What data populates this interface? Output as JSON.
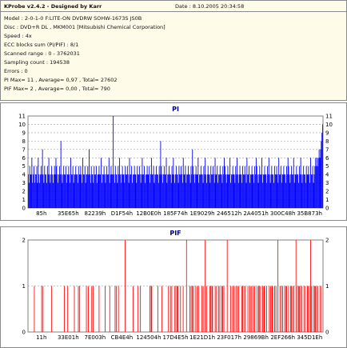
{
  "info": {
    "title": "KProbe v2.4.2 - Designed by Karr",
    "date": "Date : 8.10.2005 20:34:58",
    "lines": [
      "Model : 2-0-1-0 F:LITE-ON DVDRW SOHW-1673S JS0B",
      "Disc : DVD+R DL , MKM001 [Mitsubishi Chemical Corporation]",
      "Speed : 4x",
      "ECC blocks sum (PI/PIF) : 8/1",
      "Scanned range : 0 - 3762031",
      "Sampling count : 194538",
      "Errors : 0",
      "PI Max= 11 , Average= 0,97 , Total= 27602",
      "PIF Max= 2 , Average= 0,00 , Total= 790"
    ]
  },
  "chart_data": [
    {
      "type": "bar",
      "title": "PI",
      "ylim": [
        0,
        11
      ],
      "y_ticks": [
        0,
        1,
        2,
        3,
        4,
        5,
        6,
        7,
        8,
        9,
        10,
        11
      ],
      "x_tick_labels": [
        "85h",
        "35E65h",
        "82239h",
        "D1F54h",
        "12B0E0h",
        "185F74h",
        "1E9029h",
        "246512h",
        "2A4051h",
        "300C48h",
        "35B873h"
      ],
      "grid": true,
      "color": "#0000ff",
      "series": [
        {
          "values": [
            4,
            3,
            5,
            4,
            4,
            6,
            3,
            4,
            5,
            3,
            4,
            4,
            5,
            3,
            6,
            4,
            3,
            4,
            5,
            4,
            7,
            4,
            3,
            5,
            4,
            4,
            3,
            5,
            4,
            6,
            4,
            3,
            4,
            5,
            4,
            3,
            4,
            5,
            4,
            6,
            5,
            4,
            3,
            4,
            5,
            4,
            8,
            4,
            3,
            4,
            5,
            4,
            4,
            5,
            3,
            4,
            4,
            5,
            4,
            3,
            6,
            4,
            4,
            5,
            3,
            4,
            4,
            5,
            4,
            4,
            3,
            5,
            4,
            4,
            5,
            4,
            3,
            6,
            4,
            4,
            5,
            3,
            4,
            4,
            5,
            4,
            7,
            4,
            3,
            5,
            4,
            4,
            3,
            5,
            4,
            4,
            5,
            3,
            4,
            4,
            5,
            4,
            4,
            6,
            3,
            4,
            4,
            5,
            4,
            3,
            4,
            5,
            4,
            4,
            6,
            3,
            4,
            5,
            4,
            4,
            11,
            4,
            3,
            5,
            4,
            4,
            3,
            5,
            4,
            6,
            4,
            3,
            4,
            5,
            4,
            4,
            3,
            5,
            4,
            4,
            5,
            4,
            3,
            6,
            4,
            4,
            5,
            3,
            4,
            4,
            5,
            4,
            4,
            3,
            5,
            4,
            4,
            5,
            4,
            3,
            4,
            6,
            4,
            4,
            5,
            3,
            4,
            4,
            5,
            4,
            4,
            5,
            3,
            4,
            6,
            4,
            4,
            5,
            3,
            4,
            4,
            5,
            4,
            4,
            3,
            5,
            4,
            8,
            5,
            4,
            3,
            4,
            5,
            4,
            4,
            6,
            3,
            4,
            4,
            5,
            4,
            4,
            3,
            5,
            4,
            6,
            4,
            3,
            4,
            5,
            4,
            4,
            3,
            5,
            4,
            4,
            5,
            4,
            3,
            6,
            4,
            4,
            5,
            3,
            4,
            4,
            5,
            4,
            4,
            3,
            5,
            4,
            7,
            5,
            4,
            3,
            4,
            5,
            4,
            4,
            6,
            3,
            4,
            4,
            5,
            4,
            4,
            3,
            5,
            4,
            6,
            4,
            3,
            4,
            5,
            4,
            4,
            3,
            5,
            4,
            4,
            5,
            4,
            3,
            6,
            4,
            4,
            5,
            3,
            4,
            4,
            5,
            4,
            4,
            3,
            5,
            4,
            6,
            5,
            4,
            3,
            4,
            5,
            4,
            4,
            6,
            3,
            4,
            4,
            5,
            4,
            4,
            3,
            5,
            4,
            6,
            4,
            3,
            4,
            5,
            4,
            4,
            3,
            5,
            4,
            4,
            5,
            4,
            3,
            6,
            4,
            4,
            5,
            3,
            4,
            4,
            5,
            4,
            4,
            3,
            5,
            4,
            6,
            5,
            4,
            3,
            4,
            5,
            4,
            4,
            6,
            3,
            4,
            4,
            5,
            4,
            4,
            3,
            5,
            4,
            6,
            4,
            3,
            4,
            5,
            4,
            4,
            3,
            5,
            4,
            4,
            5,
            4,
            3,
            6,
            4,
            4,
            5,
            3,
            4,
            4,
            5,
            4,
            4,
            3,
            5,
            4,
            6,
            5,
            4,
            3,
            4,
            5,
            4,
            4,
            6,
            3,
            4,
            4,
            5,
            4,
            4,
            3,
            5,
            4,
            6,
            4,
            3,
            4,
            5,
            4,
            4,
            3,
            5,
            4,
            4,
            5,
            4,
            3,
            6,
            4,
            4,
            5,
            3,
            4,
            5,
            6,
            5,
            6,
            5,
            6,
            7,
            6,
            7,
            8,
            9,
            10
          ]
        }
      ]
    },
    {
      "type": "bar",
      "title": "PIF",
      "ylim": [
        0,
        2
      ],
      "y_ticks": [
        0,
        1,
        2
      ],
      "x_tick_labels": [
        "11h",
        "33E01h",
        "7E003h",
        "CB4E4h",
        "124504h",
        "17D4E5h",
        "1E21D1h",
        "23F017h",
        "29869Bh",
        "2EF266h",
        "345D1Eh"
      ],
      "grid": true,
      "color": "#ff0000",
      "series": [
        {
          "values": [
            0,
            0,
            0,
            0,
            0,
            0,
            0,
            0,
            0,
            1,
            0,
            0,
            0,
            0,
            0,
            0,
            0,
            0,
            0,
            0,
            1,
            0,
            1,
            0,
            0,
            0,
            0,
            0,
            0,
            0,
            0,
            0,
            0,
            0,
            0,
            1,
            0,
            0,
            0,
            0,
            0,
            0,
            0,
            0,
            0,
            0,
            0,
            0,
            0,
            0,
            0,
            0,
            0,
            0,
            1,
            0,
            0,
            0,
            0,
            1,
            0,
            0,
            0,
            0,
            0,
            0,
            0,
            0,
            0,
            1,
            0,
            0,
            0,
            0,
            0,
            1,
            0,
            1,
            0,
            0,
            0,
            0,
            0,
            0,
            0,
            0,
            0,
            1,
            0,
            0,
            1,
            0,
            0,
            0,
            0,
            1,
            0,
            1,
            0,
            0,
            0,
            0,
            0,
            0,
            0,
            0,
            1,
            0,
            0,
            0,
            0,
            0,
            0,
            0,
            0,
            1,
            0,
            0,
            0,
            0,
            0,
            0,
            1,
            0,
            0,
            0,
            0,
            0,
            0,
            0,
            1,
            0,
            1,
            0,
            0,
            1,
            0,
            0,
            0,
            0,
            0,
            0,
            0,
            0,
            0,
            2,
            0,
            0,
            0,
            0,
            0,
            0,
            0,
            0,
            0,
            0,
            0,
            1,
            0,
            0,
            0,
            0,
            0,
            0,
            1,
            0,
            0,
            0,
            1,
            0,
            0,
            0,
            0,
            0,
            0,
            0,
            0,
            0,
            0,
            0,
            0,
            0,
            1,
            0,
            1,
            1,
            0,
            0,
            0,
            0,
            0,
            0,
            0,
            0,
            1,
            0,
            0,
            0,
            0,
            0,
            1,
            0,
            0,
            0,
            0,
            0,
            0,
            0,
            0,
            0,
            1,
            0,
            0,
            1,
            0,
            1,
            0,
            0,
            0,
            1,
            0,
            1,
            0,
            1,
            1,
            0,
            0,
            0,
            1,
            0,
            0,
            0,
            1,
            0,
            0,
            0,
            0,
            2,
            0,
            0,
            0,
            0,
            1,
            0,
            1,
            0,
            1,
            1,
            0,
            0,
            1,
            0,
            0,
            1,
            0,
            1,
            0,
            0,
            0,
            0,
            1,
            0,
            1,
            0,
            0,
            2,
            0,
            1,
            0,
            0,
            0,
            0,
            1,
            1,
            0,
            1,
            1,
            0,
            0,
            0,
            1,
            0,
            1,
            0,
            0,
            1,
            0,
            1,
            0,
            0,
            1,
            1,
            0,
            1,
            0,
            0,
            0,
            0,
            2,
            0,
            0,
            0,
            0,
            1,
            0,
            0,
            1,
            0,
            1,
            0,
            0,
            1,
            0,
            1,
            0,
            1,
            0,
            0,
            0,
            0,
            1,
            1,
            0,
            1,
            0,
            1,
            0,
            0,
            0,
            1,
            0,
            0,
            1,
            0,
            1,
            0,
            0,
            1,
            0,
            1,
            0,
            0,
            0,
            1,
            0,
            1,
            1,
            0,
            1,
            0,
            0,
            1,
            0,
            1,
            1,
            0,
            0,
            1,
            0,
            0,
            0,
            1,
            0,
            1,
            0,
            1,
            1,
            0,
            0,
            1,
            0,
            1,
            0,
            0,
            2,
            0,
            0,
            1,
            0,
            1,
            0,
            1,
            0,
            0,
            1,
            0,
            1,
            1,
            0,
            0,
            1,
            0,
            0,
            1,
            1,
            0,
            1,
            0,
            1,
            0,
            0,
            2,
            0,
            1,
            0,
            1,
            1,
            0,
            1,
            0,
            1,
            0,
            0,
            1,
            0,
            1,
            0,
            0,
            1,
            1,
            0,
            1,
            0,
            2,
            1,
            0,
            0,
            1,
            0,
            1,
            1,
            0,
            1,
            0,
            1,
            0,
            0,
            1,
            0,
            1,
            0,
            0
          ]
        }
      ]
    }
  ]
}
